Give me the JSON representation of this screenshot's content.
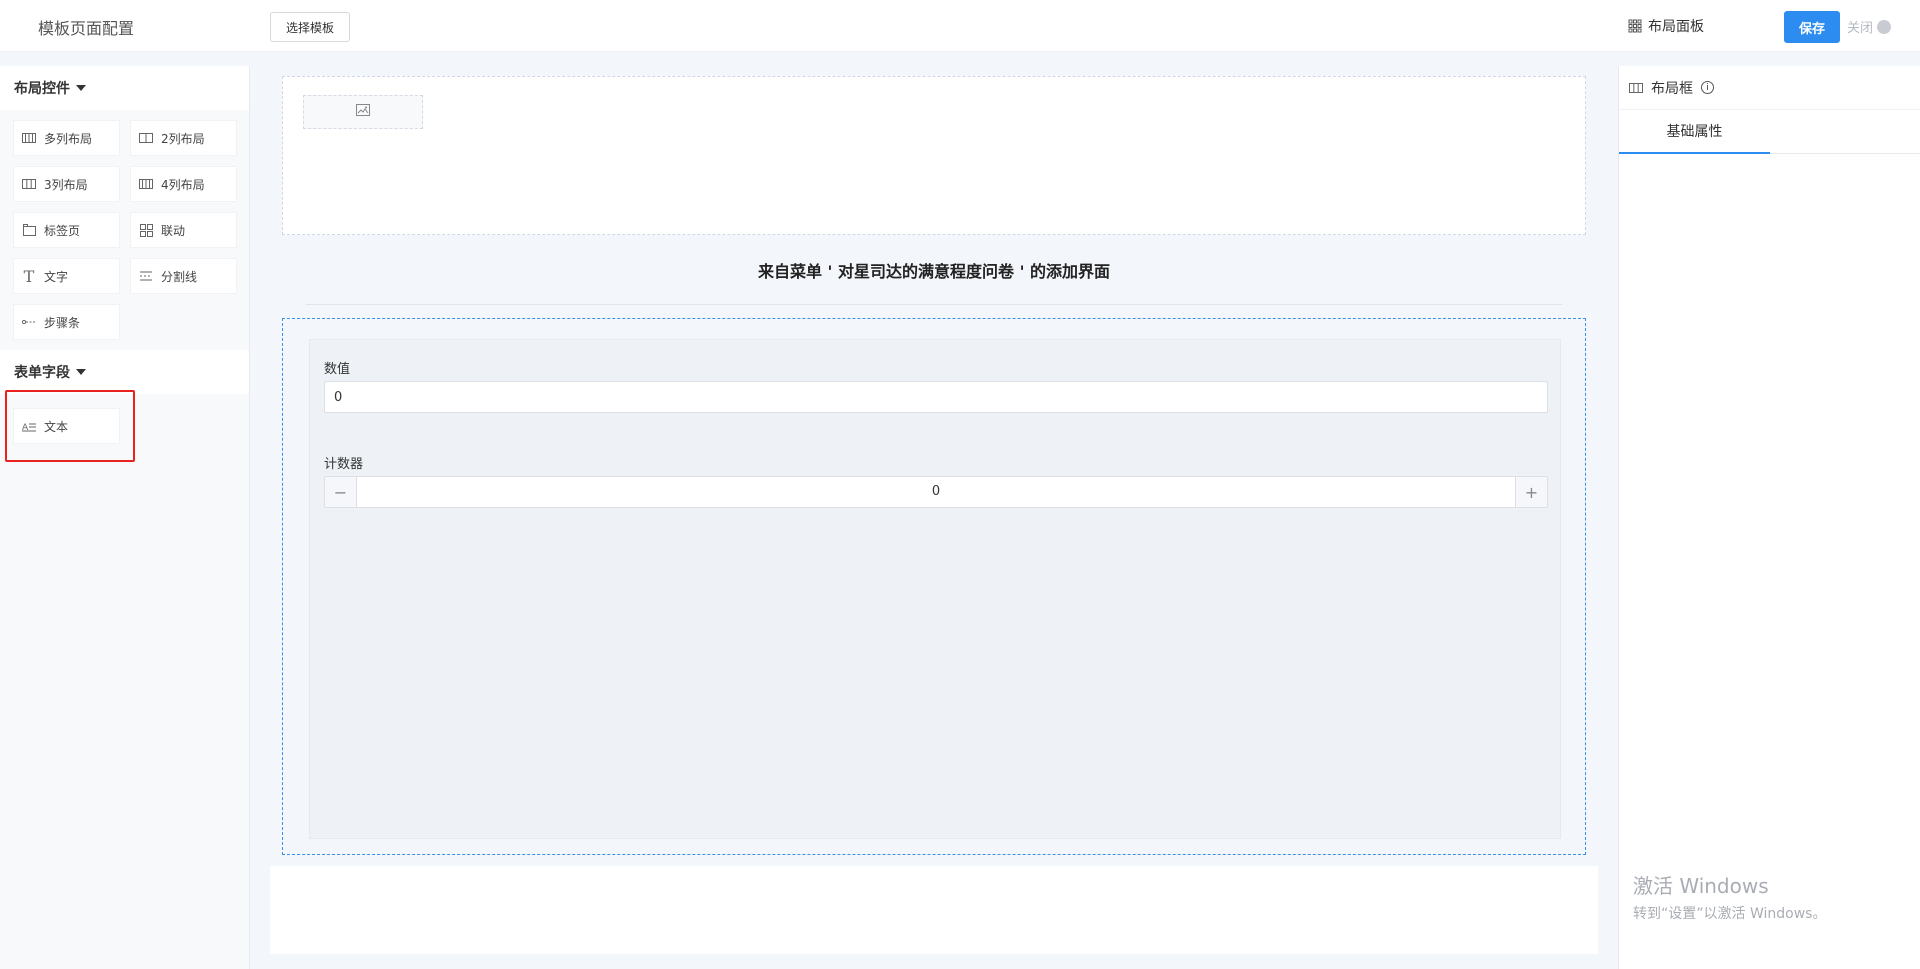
{
  "header": {
    "title": "模板页面配置",
    "select_template": "选择模板",
    "layout_panel": "布局面板",
    "save": "保存",
    "close": "关闭"
  },
  "left": {
    "layout_group": "布局控件",
    "layout_items": [
      {
        "label": "多列布局",
        "icon": "columns-icon"
      },
      {
        "label": "2列布局",
        "icon": "two-col-icon"
      },
      {
        "label": "3列布局",
        "icon": "three-col-icon"
      },
      {
        "label": "4列布局",
        "icon": "four-col-icon"
      },
      {
        "label": "标签页",
        "icon": "tab-page-icon"
      },
      {
        "label": "联动",
        "icon": "linkage-icon"
      },
      {
        "label": "文字",
        "icon": "text-t-icon"
      },
      {
        "label": "分割线",
        "icon": "divider-icon"
      },
      {
        "label": "步骤条",
        "icon": "steps-icon"
      }
    ],
    "form_group": "表单字段",
    "form_items": [
      {
        "label": "文本",
        "icon": "text-field-icon"
      }
    ]
  },
  "canvas": {
    "form_title": "来自菜单 ' 对星司达的满意程度问卷 ' 的添加界面",
    "fields": {
      "number_label": "数值",
      "number_value": "0",
      "counter_label": "计数器",
      "counter_value": "0",
      "minus": "−",
      "plus": "+"
    }
  },
  "right": {
    "title": "布局框",
    "tab": "基础属性"
  },
  "watermark": {
    "line1": "激活 Windows",
    "line2": "转到“设置”以激活 Windows。"
  }
}
